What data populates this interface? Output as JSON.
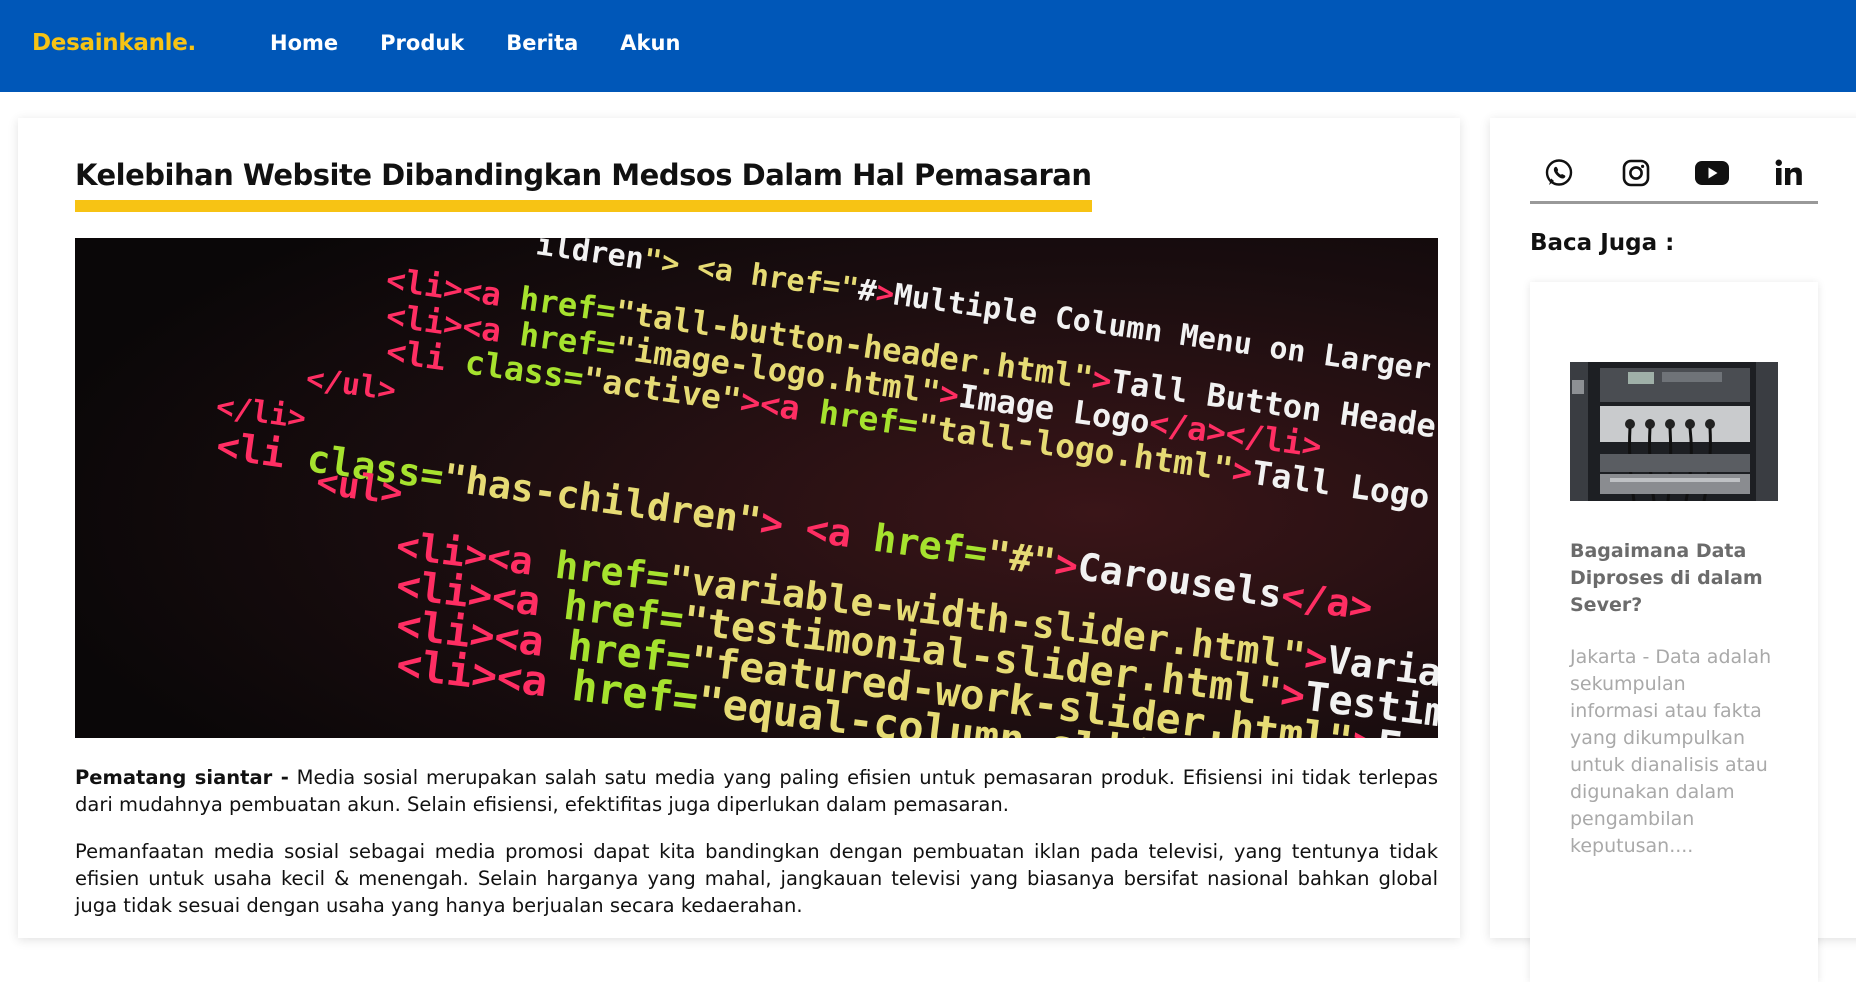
{
  "brand": "Desainkanle.",
  "nav": [
    "Home",
    "Produk",
    "Berita",
    "Akun"
  ],
  "article": {
    "title": "Kelebihan Website Dibandingkan Medsos Dalam Hal Pemasaran",
    "image_alt": "code-screen-image",
    "code_lines": [
      "ildren\"> <a href=\"#\">Multiple Column Menu on Larger Viewports</a></li>",
      "<li><a href=\"tall-button-header.html\">Tall Button Header Options</a>",
      "<li><a href=\"image-logo.html\">Image Logo</a></li>",
      "<li class=\"active\"><a href=\"tall-logo.html\">Tall Logo Image</a>",
      "</ul>",
      "</li>",
      "<li class=\"has-children\"> <a href=\"#\">Carousels</a>",
      "<ul>",
      "<li><a href=\"variable-width-slider.html\">Variable Image Wi",
      "<li><a href=\"testimonial-slider.html\">Testimonial Slider<",
      "<li><a href=\"featured-work-slider.html\">Featured Work Sli",
      "<li><a href=\"equal-column-slider.html\">Equal Co"
    ],
    "lead_label": "Pematang siantar -",
    "paragraph1": " Media sosial merupakan salah satu media yang paling efisien untuk pemasaran produk. Efisiensi ini tidak terlepas dari mudahnya pembuatan akun. Selain efisiensi, efektifitas juga diperlukan dalam pemasaran.",
    "paragraph2": "Pemanfaatan media sosial sebagai media promosi dapat kita bandingkan dengan pembuatan iklan pada televisi, yang tentunya tidak efisien untuk usaha kecil & menengah. Selain harganya yang mahal, jangkauan televisi yang biasanya bersifat nasional bahkan global juga tidak sesuai dengan usaha yang hanya berjualan secara kedaerahan."
  },
  "sidebar": {
    "social": [
      "whatsapp-icon",
      "instagram-icon",
      "youtube-icon",
      "linkedin-icon"
    ],
    "heading": "Baca Juga :",
    "related": {
      "title": "Bagaimana Data Diproses di dalam Sever?",
      "excerpt": "Jakarta - Data adalah sekumpulan informasi atau fakta yang dikumpulkan untuk dianalisis atau digunakan dalam pengambilan keputusan...."
    }
  },
  "colors": {
    "navbar": "#0057b8",
    "brand": "#f7c314",
    "title_underline": "#f7c314",
    "code_tag": "#ff2e63",
    "code_attr": "#a6e22e",
    "code_string": "#e6db74",
    "code_text": "#f2f2f2"
  }
}
